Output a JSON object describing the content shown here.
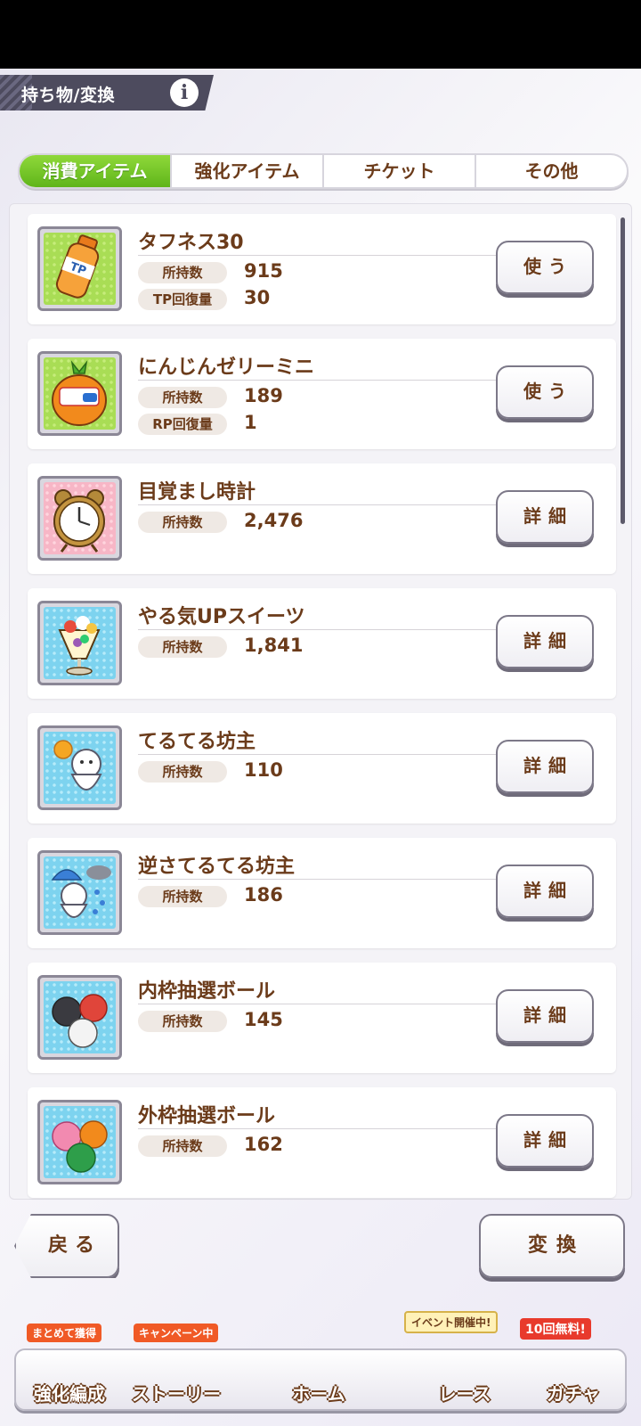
{
  "header": {
    "title": "持ち物/変換",
    "info_label": "i"
  },
  "tabs": [
    {
      "label": "消費アイテム",
      "active": true
    },
    {
      "label": "強化アイテム",
      "active": false
    },
    {
      "label": "チケット",
      "active": false
    },
    {
      "label": "その他",
      "active": false
    }
  ],
  "items": [
    {
      "name": "タフネス30",
      "owned_label": "所持数",
      "owned": "915",
      "extra_label": "TP回復量",
      "extra": "30",
      "action": "使う",
      "icon": "tp-bottle-icon",
      "color": "green"
    },
    {
      "name": "にんじんゼリーミニ",
      "owned_label": "所持数",
      "owned": "189",
      "extra_label": "RP回復量",
      "extra": "1",
      "action": "使う",
      "icon": "carrot-jelly-icon",
      "color": "green"
    },
    {
      "name": "目覚まし時計",
      "owned_label": "所持数",
      "owned": "2,476",
      "action": "詳細",
      "icon": "alarm-clock-icon",
      "color": "pink"
    },
    {
      "name": "やる気UPスイーツ",
      "owned_label": "所持数",
      "owned": "1,841",
      "action": "詳細",
      "icon": "parfait-icon",
      "color": "blue"
    },
    {
      "name": "てるてる坊主",
      "owned_label": "所持数",
      "owned": "110",
      "action": "詳細",
      "icon": "teru-teru-bozu-icon",
      "color": "blue"
    },
    {
      "name": "逆さてるてる坊主",
      "owned_label": "所持数",
      "owned": "186",
      "action": "詳細",
      "icon": "upside-down-teru-teru-bozu-icon",
      "color": "blue"
    },
    {
      "name": "内枠抽選ボール",
      "owned_label": "所持数",
      "owned": "145",
      "action": "詳細",
      "icon": "lottery-ball-inner-icon",
      "color": "blue"
    },
    {
      "name": "外枠抽選ボール",
      "owned_label": "所持数",
      "owned": "162",
      "action": "詳細",
      "icon": "lottery-ball-outer-icon",
      "color": "blue"
    }
  ],
  "buttons": {
    "back": "戻る",
    "convert": "変換"
  },
  "bottom_nav": [
    {
      "label": "強化編成",
      "badge": "まとめて獲得"
    },
    {
      "label": "ストーリー",
      "badge": "キャンペーン中"
    },
    {
      "label": "ホーム",
      "badge": ""
    },
    {
      "label": "レース",
      "badge": "イベント開催中!"
    },
    {
      "label": "ガチャ",
      "badge": "10回無料!"
    }
  ],
  "scroll": {
    "position_fraction": 0.0,
    "visible_fraction": 0.32
  }
}
